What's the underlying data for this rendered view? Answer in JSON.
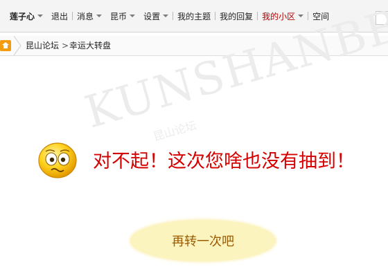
{
  "nav": {
    "user": "莲子心",
    "logout": "退出",
    "messages": "消息",
    "coins": "昆币",
    "settings": "设置",
    "my_topics": "我的主题",
    "my_replies": "我的回复",
    "my_community": "我的小区",
    "space": "空间"
  },
  "breadcrumb": {
    "home_icon": "home-icon",
    "items": [
      "昆山论坛",
      "幸运大转盘"
    ],
    "separator": ">"
  },
  "main": {
    "watermark": "KUNSHANBBS",
    "watermark_cn": "昆山论坛",
    "message": "对不起！这次您啥也没有抽到！",
    "retry_label": "再转一次吧"
  },
  "colors": {
    "accent_red": "#d40000",
    "button_fill": "#fbf4bf",
    "button_text": "#9b5a00"
  }
}
